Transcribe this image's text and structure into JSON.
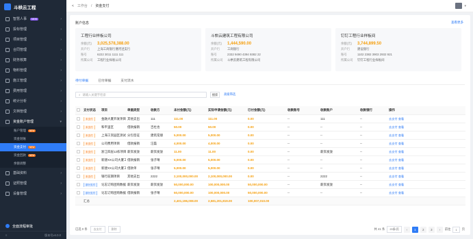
{
  "sidebar": {
    "title": "斗栱云工程",
    "items": [
      {
        "label": "智慧人事",
        "badge": "NEW"
      },
      {
        "label": "投标管理"
      },
      {
        "label": "项目管理"
      },
      {
        "label": "合同管理"
      },
      {
        "label": "财务核算"
      },
      {
        "label": "物料管理"
      },
      {
        "label": "施工管理"
      },
      {
        "label": "费用管理"
      },
      {
        "label": "统计分析"
      },
      {
        "label": "文档管理"
      },
      {
        "label": "资金账户管理"
      }
    ],
    "subitems": [
      {
        "label": "账户管理",
        "tag": "NEW"
      },
      {
        "label": "资金划账"
      },
      {
        "label": "资金支付",
        "tag": "NEW"
      },
      {
        "label": "资金回款",
        "tag": "NEW"
      },
      {
        "label": "余额调整"
      }
    ],
    "after": [
      {
        "label": "基础资料"
      },
      {
        "label": "证照管理"
      },
      {
        "label": "设备管理"
      }
    ],
    "workflow": "全面流程审批",
    "version_label": "版本号v4.0.0"
  },
  "topbar": {
    "back": "<",
    "crumb1": "工作台",
    "sep": "/",
    "crumb2": "资金支付"
  },
  "account": {
    "title": "账户信息",
    "link": "查看更多"
  },
  "cards": [
    {
      "name": "工程行业样板公司",
      "lbl1": "余额(元)",
      "amt": "3,025,578,388.00",
      "lbl2": "开户行",
      "bank": "上海工商银行漕河泾支行",
      "lbl3": "账号",
      "no": "6222 3011 1111 111",
      "lbl4": "所属公司",
      "co": "工程行业样板公司"
    },
    {
      "name": "斗栱云建筑工程有限公司",
      "lbl1": "余额(元)",
      "amt": "1,444,590.00",
      "lbl2": "开户行",
      "bank": "工商银行",
      "lbl3": "账号",
      "no": "2332 9490 4394 9382 22",
      "lbl4": "所属公司",
      "co": "斗栱云建筑工程有限公司"
    },
    {
      "name": "钉钉工程行业样板间",
      "lbl1": "余额(元)",
      "amt": "3,744,899.50",
      "lbl2": "开户行",
      "bank": "建设银行",
      "lbl3": "账号",
      "no": "1102 2382 3903 2932 921",
      "lbl4": "所属公司",
      "co": "钉钉工程行业样板间"
    }
  ],
  "tabs": [
    "待付单据",
    "已付单据",
    "支付流水"
  ],
  "search": {
    "placeholder": "请输入关键字检索",
    "btn": "搜索",
    "adv": "高级筛选"
  },
  "columns": [
    "",
    "支付状态",
    "项目",
    "单据类型",
    "收款方",
    "未付金额(元)",
    "实际申请金额(元)",
    "已付金额(元)",
    "收款账号",
    "收款账户",
    "收款银行",
    "操作"
  ],
  "rows": [
    {
      "status": "未支付",
      "blue": false,
      "project": "金融大厦开发项目",
      "type": "其他支出",
      "payee": "111",
      "unpaid": "111.00",
      "apply": "111.00",
      "paid": "0.00",
      "acc_no": "--",
      "acc": "111",
      "bank": "--",
      "op1": "去支付",
      "op2": "查看"
    },
    {
      "status": "未支付",
      "blue": false,
      "project": "和平里区",
      "type": "借款报销",
      "payee": "吉杜也",
      "unpaid": "50.00",
      "apply": "50.00",
      "paid": "0.00",
      "acc_no": "--",
      "acc": "--",
      "bank": "--",
      "op1": "去支付",
      "op2": "查看"
    },
    {
      "status": "未支付",
      "blue": false,
      "project": "上海工资园区测试项目",
      "type": "分包签证",
      "payee": "建筑常朋",
      "unpaid": "5,000.00",
      "apply": "5,000.00",
      "paid": "0.00",
      "acc_no": "--",
      "acc": "--",
      "bank": "--",
      "op1": "去支付",
      "op2": "查看"
    },
    {
      "status": "未支付",
      "blue": false,
      "project": "公司费用项目",
      "type": "借款报销",
      "payee": "汪磊",
      "unpaid": "4,000.00",
      "apply": "4,000.00",
      "paid": "0.00",
      "acc_no": "--",
      "acc": "--",
      "bank": "--",
      "op1": "去支付",
      "op2": "查看"
    },
    {
      "status": "未支付",
      "blue": false,
      "project": "浙江四层12栋项目二期",
      "type": "薪资发放",
      "payee": "薪资发放",
      "unpaid": "11.00",
      "apply": "11.00",
      "paid": "0.00",
      "acc_no": "--",
      "acc": "薪资发放",
      "bank": "--",
      "op1": "去支付",
      "op2": "查看"
    },
    {
      "status": "未支付",
      "blue": false,
      "project": "新建XX公司大厦工程",
      "type": "借款报销",
      "payee": "张子晴",
      "unpaid": "5,000.00",
      "apply": "5,000.00",
      "paid": "0.00",
      "acc_no": "--",
      "acc": "--",
      "bank": "--",
      "op1": "去支付",
      "op2": "查看"
    },
    {
      "status": "未支付",
      "blue": false,
      "project": "新建XX公司大厦工程",
      "type": "借款单",
      "payee": "张子晴",
      "unpaid": "5,000.00",
      "apply": "5,000.00",
      "paid": "0.00",
      "acc_no": "--",
      "acc": "--",
      "bank": "--",
      "op1": "去支付",
      "op2": "查看"
    },
    {
      "status": "未支付",
      "blue": false,
      "project": "银行前期项目",
      "type": "其他支出",
      "payee": "2222",
      "unpaid": "2,100,000,000.00",
      "apply": "2,100,000,000.00",
      "paid": "0.00",
      "acc_no": "--",
      "acc": "2222",
      "bank": "--",
      "op1": "去支付",
      "op2": "查看"
    },
    {
      "status": "部分支付",
      "blue": true,
      "project": "论志订购团购数据",
      "type": "薪资发放",
      "payee": "薪资发放",
      "unpaid": "50,000,000.00",
      "apply": "100,000,000.00",
      "paid": "50,000,000.00",
      "acc_no": "--",
      "acc": "薪资发放",
      "bank": "--",
      "op1": "去支付",
      "op2": "查看"
    },
    {
      "status": "部分支付",
      "blue": true,
      "project": "论志订购团购数据",
      "type": "借款报销",
      "payee": "张子晴",
      "unpaid": "50,000,000.00",
      "apply": "100,000,000.00",
      "paid": "50,000,000.00",
      "acc_no": "--",
      "acc": "--",
      "bank": "--",
      "op1": "去支付",
      "op2": "查看"
    }
  ],
  "total": {
    "label": "汇总",
    "unpaid": "2,401,196,008.00",
    "apply": "2,581,201,819.00",
    "paid": "100,007,010.00"
  },
  "footer": {
    "selected": "已选 0 条",
    "btn1": "去支付",
    "btn2": "删除",
    "count": "共 41 条",
    "pagesize": "20条/页",
    "pages": [
      "1",
      "2",
      "3"
    ],
    "goto": "前往",
    "page": "1",
    "unit": "页"
  }
}
